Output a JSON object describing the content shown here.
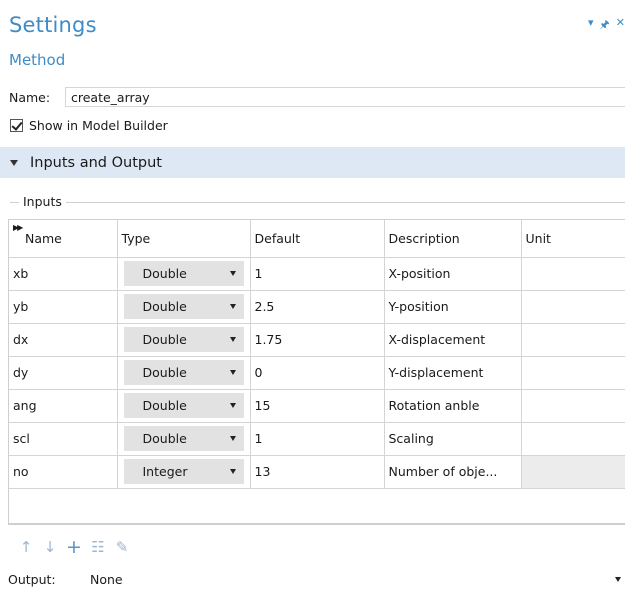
{
  "header": {
    "title": "Settings",
    "subtitle": "Method",
    "icons": [
      "dropdown-arrow-icon",
      "pin-icon",
      "close-icon"
    ]
  },
  "name_field": {
    "label": "Name:",
    "value": "create_array"
  },
  "show_in_builder": {
    "label": "Show in Model Builder",
    "checked": true
  },
  "section": {
    "label": "Inputs and Output",
    "expanded": true
  },
  "inputs_group": {
    "label": "Inputs"
  },
  "table": {
    "columns": [
      "Name",
      "Type",
      "Default",
      "Description",
      "Unit"
    ],
    "rows": [
      {
        "name": "xb",
        "type": "Double",
        "default": "1",
        "description": "X-position",
        "unit": ""
      },
      {
        "name": "yb",
        "type": "Double",
        "default": "2.5",
        "description": "Y-position",
        "unit": ""
      },
      {
        "name": "dx",
        "type": "Double",
        "default": "1.75",
        "description": "X-displacement",
        "unit": ""
      },
      {
        "name": "dy",
        "type": "Double",
        "default": "0",
        "description": "Y-displacement",
        "unit": ""
      },
      {
        "name": "ang",
        "type": "Double",
        "default": "15",
        "description": "Rotation anble",
        "unit": ""
      },
      {
        "name": "scl",
        "type": "Double",
        "default": "1",
        "description": "Scaling",
        "unit": ""
      },
      {
        "name": "no",
        "type": "Integer",
        "default": "13",
        "description": "Number of obje...",
        "unit": ""
      }
    ]
  },
  "toolbar": {
    "icons": [
      "move-up-icon",
      "move-down-icon",
      "add-icon",
      "delete-icon",
      "edit-icon"
    ]
  },
  "output": {
    "label": "Output:",
    "value": "None"
  },
  "colors": {
    "accent": "#3d8cc8",
    "section_bg": "#dde8f4",
    "select_bg": "#e2e2e2"
  }
}
